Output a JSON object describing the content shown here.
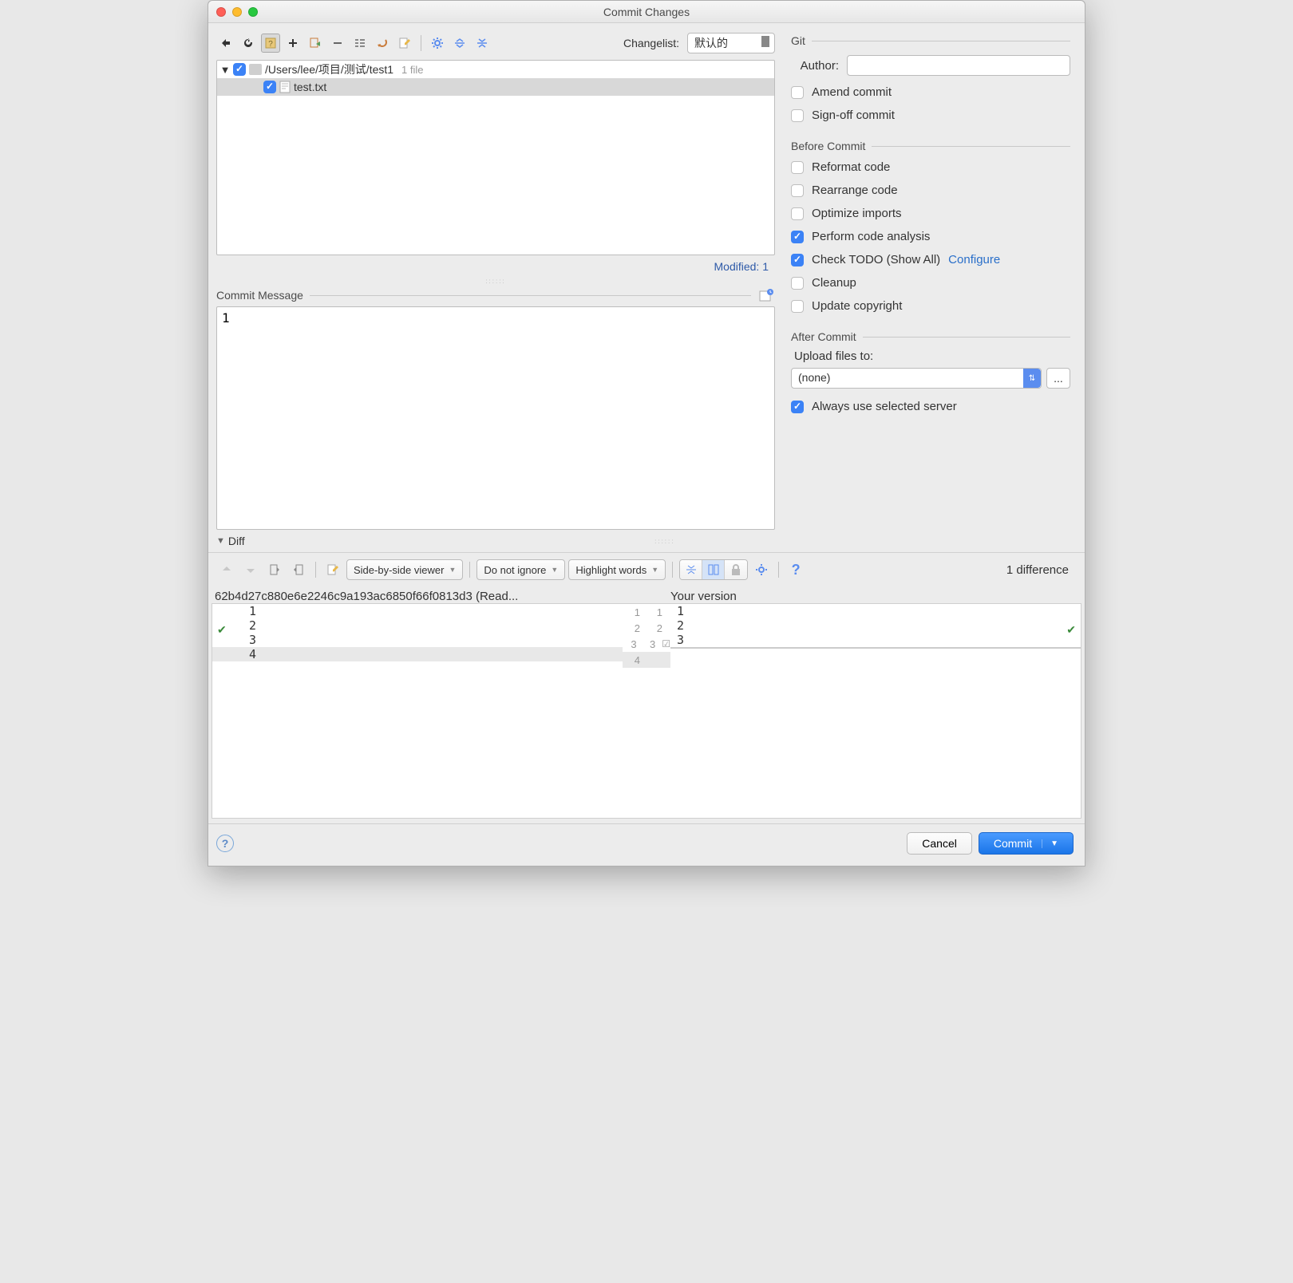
{
  "window": {
    "title": "Commit Changes"
  },
  "toolbar": {
    "changelist_label": "Changelist:",
    "changelist_value": "默认的"
  },
  "tree": {
    "root_path": "/Users/lee/项目/测试/test1",
    "file_count_label": "1 file",
    "files": [
      {
        "name": "test.txt",
        "checked": true
      }
    ],
    "modified_label": "Modified: 1"
  },
  "commit_message": {
    "label": "Commit Message",
    "value": "1"
  },
  "git": {
    "section": "Git",
    "author_label": "Author:",
    "amend": {
      "label": "Amend commit",
      "checked": false
    },
    "signoff": {
      "label": "Sign-off commit",
      "checked": false
    }
  },
  "before_commit": {
    "section": "Before Commit",
    "reformat": {
      "label": "Reformat code",
      "checked": false
    },
    "rearrange": {
      "label": "Rearrange code",
      "checked": false
    },
    "optimize": {
      "label": "Optimize imports",
      "checked": false
    },
    "analysis": {
      "label": "Perform code analysis",
      "checked": true
    },
    "todo": {
      "label": "Check TODO (Show All)",
      "configure": "Configure",
      "checked": true
    },
    "cleanup": {
      "label": "Cleanup",
      "checked": false
    },
    "copyright": {
      "label": "Update copyright",
      "checked": false
    }
  },
  "after_commit": {
    "section": "After Commit",
    "upload_label": "Upload files to:",
    "upload_value": "(none)",
    "always": {
      "label": "Always use selected server",
      "checked": true
    }
  },
  "diff": {
    "label": "Diff",
    "viewer_mode": "Side-by-side viewer",
    "ignore_mode": "Do not ignore",
    "highlight_mode": "Highlight words",
    "diff_count": "1 difference",
    "left_title": "62b4d27c880e6e2246c9a193ac6850f66f0813d3 (Read...",
    "right_title": "Your version",
    "left_lines": [
      "1",
      "2",
      "3",
      "4"
    ],
    "right_lines": [
      "1",
      "2",
      "3"
    ]
  },
  "buttons": {
    "cancel": "Cancel",
    "commit": "Commit"
  }
}
